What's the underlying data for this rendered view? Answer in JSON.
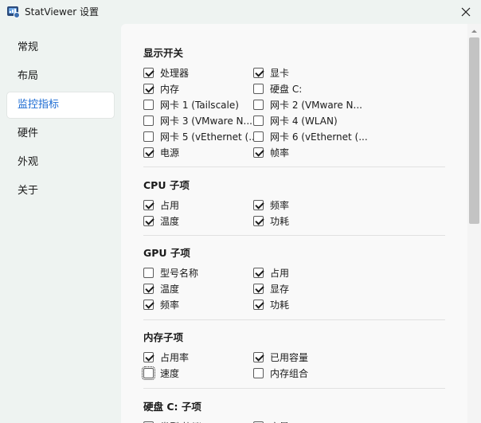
{
  "window": {
    "title": "StatViewer 设置"
  },
  "sidebar": {
    "items": [
      {
        "label": "常规",
        "active": false
      },
      {
        "label": "布局",
        "active": false
      },
      {
        "label": "监控指标",
        "active": true
      },
      {
        "label": "硬件",
        "active": false
      },
      {
        "label": "外观",
        "active": false
      },
      {
        "label": "关于",
        "active": false
      }
    ]
  },
  "sections": [
    {
      "title": "显示开关",
      "items": [
        {
          "label": "处理器",
          "checked": true
        },
        {
          "label": "显卡",
          "checked": true
        },
        {
          "label": "内存",
          "checked": true
        },
        {
          "label": "硬盘 C:",
          "checked": false
        },
        {
          "label": "网卡 1 (Tailscale)",
          "checked": false
        },
        {
          "label": "网卡 2 (VMware N...",
          "checked": false
        },
        {
          "label": "网卡 3 (VMware N...",
          "checked": false
        },
        {
          "label": "网卡 4 (WLAN)",
          "checked": false
        },
        {
          "label": "网卡 5 (vEthernet (...",
          "checked": false
        },
        {
          "label": "网卡 6 (vEthernet (...",
          "checked": false
        },
        {
          "label": "电源",
          "checked": true
        },
        {
          "label": "帧率",
          "checked": true
        }
      ]
    },
    {
      "title": "CPU 子项",
      "items": [
        {
          "label": "占用",
          "checked": true
        },
        {
          "label": "频率",
          "checked": true
        },
        {
          "label": "温度",
          "checked": true
        },
        {
          "label": "功耗",
          "checked": true
        }
      ]
    },
    {
      "title": "GPU 子项",
      "items": [
        {
          "label": "型号名称",
          "checked": false
        },
        {
          "label": "占用",
          "checked": true
        },
        {
          "label": "温度",
          "checked": true
        },
        {
          "label": "显存",
          "checked": true
        },
        {
          "label": "频率",
          "checked": true
        },
        {
          "label": "功耗",
          "checked": true
        }
      ]
    },
    {
      "title": "内存子项",
      "items": [
        {
          "label": "占用率",
          "checked": true
        },
        {
          "label": "已用容量",
          "checked": true
        },
        {
          "label": "速度",
          "checked": false,
          "focused": true
        },
        {
          "label": "内存组合",
          "checked": false
        }
      ]
    },
    {
      "title": "硬盘 C: 子项",
      "items": [
        {
          "label": "类型/协议",
          "checked": true
        },
        {
          "label": "容量",
          "checked": true
        }
      ]
    }
  ]
}
